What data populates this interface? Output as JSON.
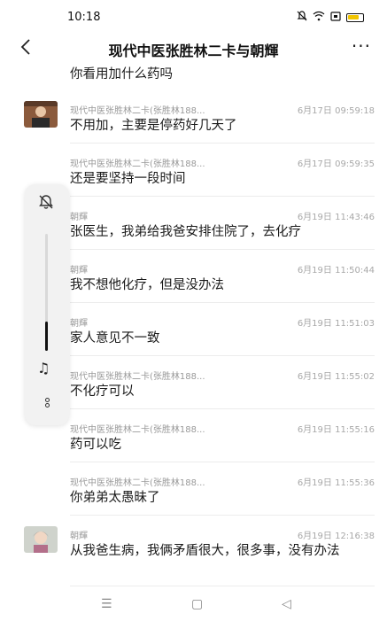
{
  "status_bar": {
    "time": "10:18",
    "icons": [
      "mute-icon",
      "wifi-icon",
      "sim-icon",
      "battery-icon"
    ]
  },
  "header": {
    "back_icon": "‹",
    "title": "现代中医张胜林二卡与朝輝",
    "more_icon": "···"
  },
  "first_message_tail": "你看用加什么药吗",
  "messages": [
    {
      "sender": "",
      "time": "6月17日 09:59:18",
      "text": "不用加，主要是停药好几天了",
      "avatar": true
    },
    {
      "sender": "现代中医张胜林二卡(张胜林188...",
      "time": "6月17日 09:59:35",
      "text": "还是要坚持一段时间",
      "avatar": false
    },
    {
      "sender": "朝輝",
      "time": "6月19日 11:43:46",
      "text": "张医生，我弟给我爸安排住院了，去化疗",
      "avatar": false
    },
    {
      "sender": "朝輝",
      "time": "6月19日 11:50:44",
      "text": "我不想他化疗，但是没办法",
      "avatar": false
    },
    {
      "sender": "朝輝",
      "time": "6月19日 11:51:03",
      "text": "家人意见不一致",
      "avatar": false
    },
    {
      "sender": "现代中医张胜林二卡(张胜林188...",
      "time": "6月19日 11:55:02",
      "text": "不化疗可以",
      "avatar": false
    },
    {
      "sender": "现代中医张胜林二卡(张胜林188...",
      "time": "6月19日 11:55:16",
      "text": "药可以吃",
      "avatar": false
    },
    {
      "sender": "现代中医张胜林二卡(张胜林188...",
      "time": "6月19日 11:55:36",
      "text": "你弟弟太愚昧了",
      "avatar": false
    },
    {
      "sender": "朝輝",
      "time": "6月19日 12:16:38",
      "text": "从我爸生病，我俩矛盾很大，很多事，没有办法",
      "avatar": true
    }
  ],
  "first_sender_partial": "现代中医张胜林二卡(张胜林188...",
  "side_widget": {
    "mute_icon": "bell-off-icon",
    "volume_level": 0.25,
    "music_icon": "♫",
    "more_icon": "dots-icon"
  },
  "nav_bar": {
    "menu": "☰",
    "home": "▢",
    "back": "◁"
  },
  "colors": {
    "text": "#1a1a1a",
    "meta": "#9a9a9a",
    "divider": "#ececec",
    "battery": "#f2c500"
  }
}
